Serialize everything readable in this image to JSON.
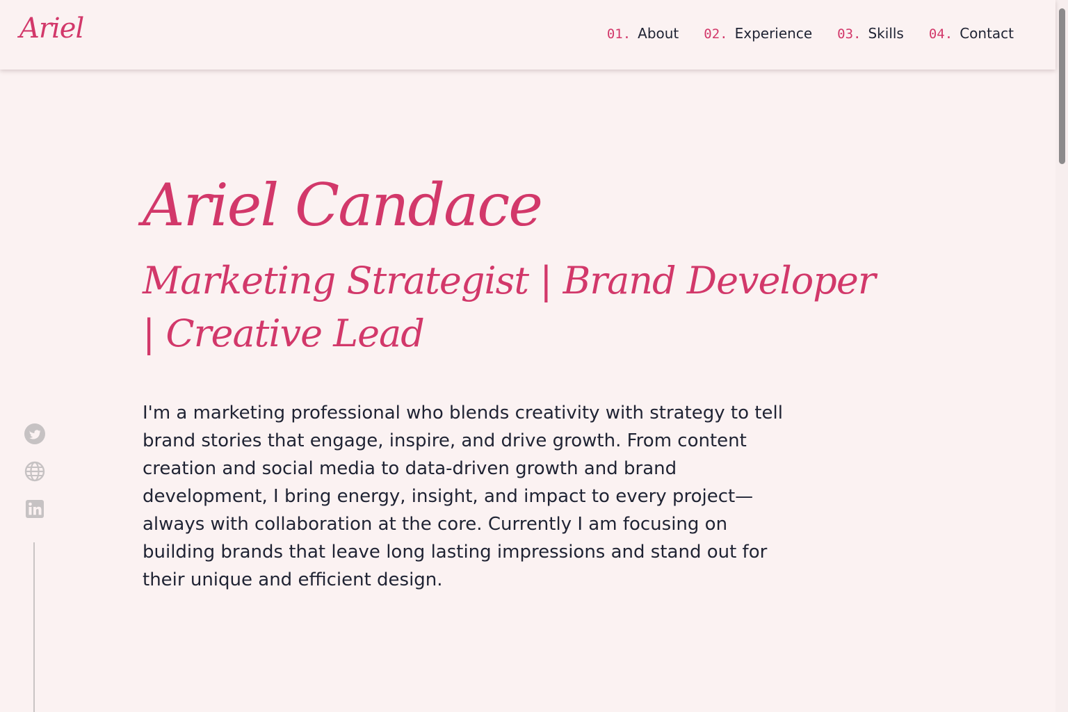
{
  "header": {
    "logo": "Ariel",
    "nav": [
      {
        "num": "01.",
        "label": "About"
      },
      {
        "num": "02.",
        "label": "Experience"
      },
      {
        "num": "03.",
        "label": "Skills"
      },
      {
        "num": "04.",
        "label": "Contact"
      }
    ]
  },
  "hero": {
    "name": "Ariel Candace",
    "role": "Marketing Strategist | Brand Developer | Creative Lead",
    "bio": "I'm a marketing professional who blends creativity with strategy to tell brand stories that engage, inspire, and drive growth. From content creation and social media to data-driven growth and brand development, I bring energy, insight, and impact to every project—always with collaboration at the core. Currently I am focusing on building brands that leave long lasting impressions and stand out for their unique and efficient design."
  },
  "social": [
    {
      "icon": "twitter-icon"
    },
    {
      "icon": "globe-icon"
    },
    {
      "icon": "linkedin-icon"
    }
  ],
  "colors": {
    "background": "#fbf2f2",
    "accent": "#d2386a",
    "text": "#1f2333",
    "muted": "#c9c4c4"
  }
}
